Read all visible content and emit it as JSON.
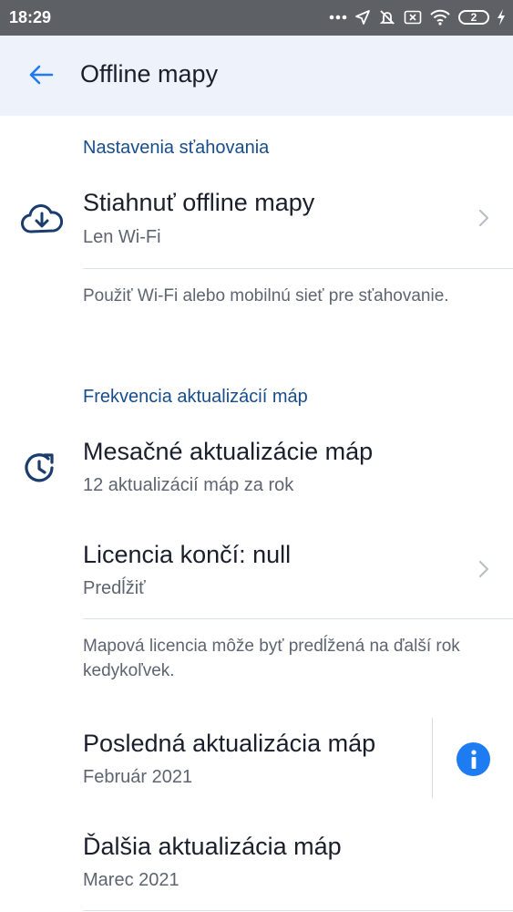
{
  "status_bar": {
    "time": "18:29",
    "battery_level": "2",
    "icons": [
      "more-dots-icon",
      "location-arrow-icon",
      "alarm-off-icon",
      "sim-x-icon",
      "wifi-icon",
      "battery-icon",
      "charging-bolt-icon"
    ]
  },
  "app_bar": {
    "title": "Offline mapy",
    "back_icon": "arrow-left-icon"
  },
  "download_section": {
    "header": "Nastavenia sťahovania",
    "download_row": {
      "title": "Stiahnuť offline mapy",
      "subtitle": "Len Wi-Fi",
      "icon": "cloud-download-icon"
    },
    "description": "Použiť Wi-Fi alebo mobilnú sieť pre sťahovanie."
  },
  "update_section": {
    "header": "Frekvencia aktualizácií máp",
    "monthly_row": {
      "title": "Mesačné aktualizácie máp",
      "subtitle": "12 aktualizácií máp za rok",
      "icon": "clock-refresh-icon"
    },
    "license_row": {
      "title": "Licencia končí: null",
      "subtitle": "Predĺžiť"
    },
    "license_description": "Mapová licencia môže byť predĺžená na ďalší rok kedykoľvek.",
    "last_update_row": {
      "title": "Posledná aktualizácia máp",
      "subtitle": "Február 2021",
      "info_icon": "info-icon"
    },
    "next_update_row": {
      "title": "Ďalšia aktualizácia máp",
      "subtitle": "Marec 2021"
    }
  },
  "colors": {
    "accent": "#1e7cf2",
    "section_header": "#174d8c",
    "app_bar_bg": "#eef3fb",
    "status_bar_bg": "#5d6166"
  }
}
